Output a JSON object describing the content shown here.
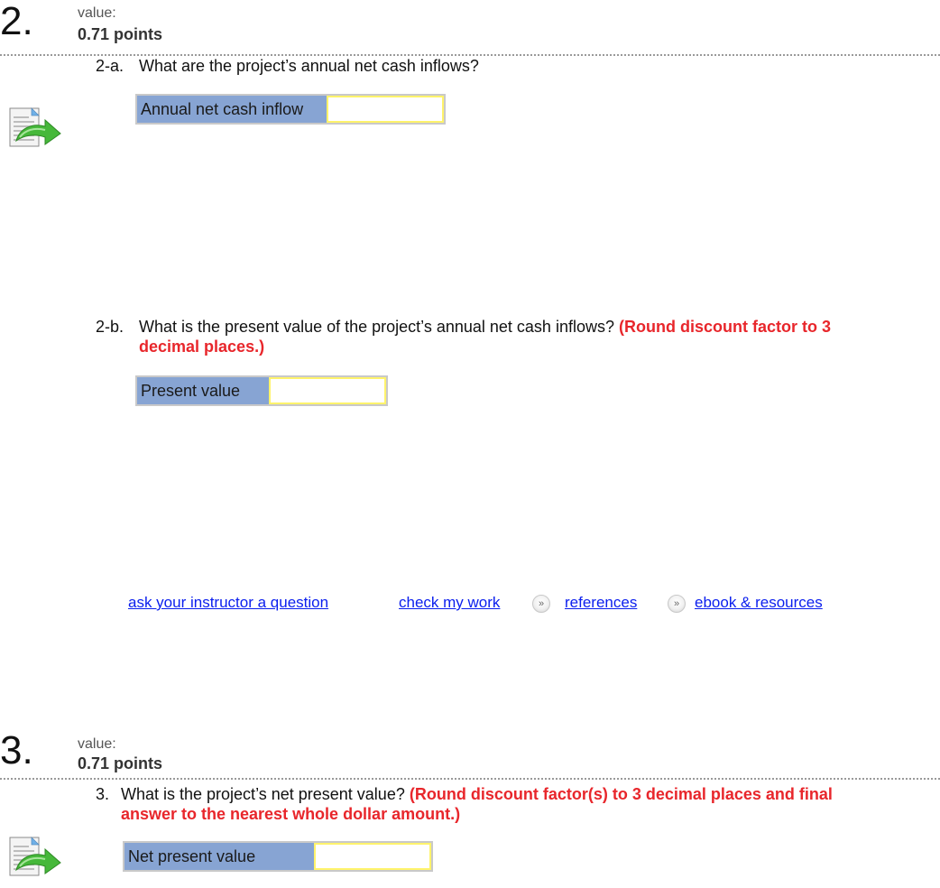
{
  "question2": {
    "number": "2.",
    "value_label": "value:",
    "points": "0.71 points",
    "part_a": {
      "number": "2-a.",
      "prompt": "What are the project’s annual net cash inflows?",
      "field_label": "Annual net cash inflow",
      "field_value": ""
    },
    "part_b": {
      "number": "2-b.",
      "prompt": "What is the present value of the project’s annual net cash inflows?",
      "hint_line1": "(Round discount factor to 3",
      "hint_line2": "decimal places.)",
      "field_label": "Present value",
      "field_value": ""
    },
    "links": {
      "ask_instructor": "ask your instructor a question",
      "check_work": "check my work",
      "references": "references",
      "ebook": "ebook & resources"
    }
  },
  "question3": {
    "number": "3.",
    "value_label": "value:",
    "points": "0.71 points",
    "part": {
      "number": "3.",
      "prompt": "What is the project’s net present value?",
      "hint_line1": "(Round discount factor(s) to 3 decimal places and final",
      "hint_line2": "answer to the nearest whole dollar amount.)",
      "field_label": "Net present value",
      "field_value": ""
    }
  },
  "colors": {
    "label_bg": "#87a4d3",
    "input_border": "#fff36b",
    "hint_red": "#e8262b",
    "link_blue": "#0a1eee"
  }
}
